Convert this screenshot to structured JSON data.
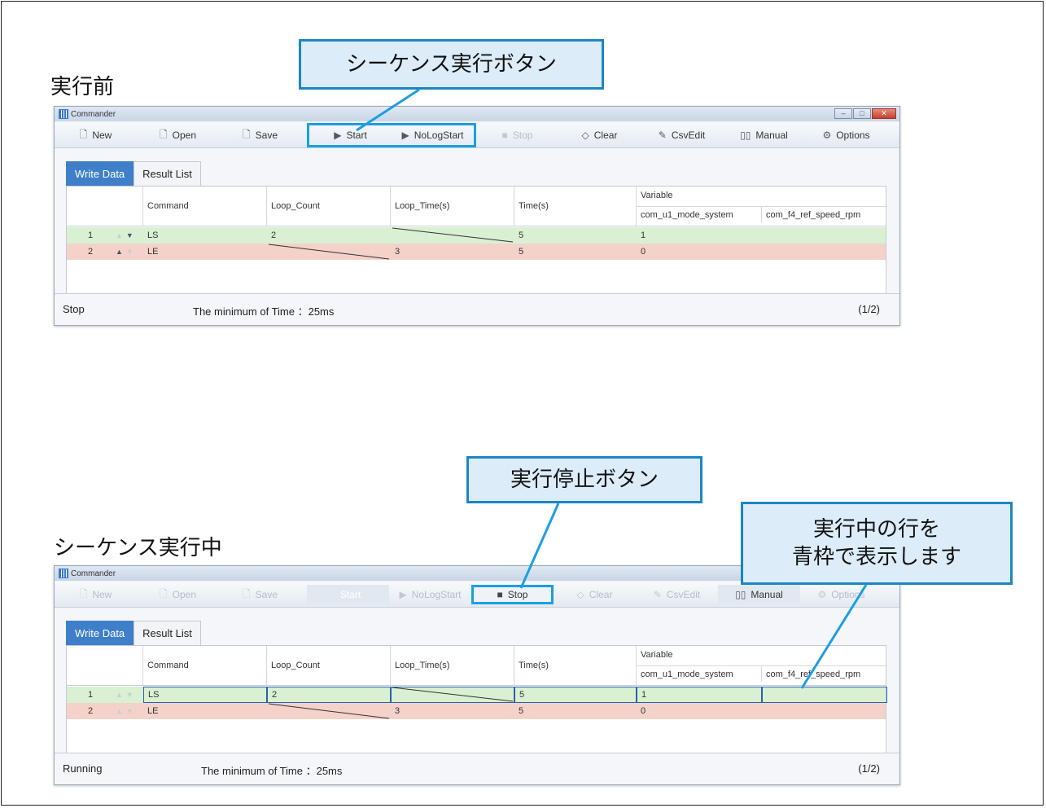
{
  "top": {
    "heading": "実行前",
    "callout": "シーケンス実行ボタン",
    "window": {
      "title": "Commander",
      "toolbar": [
        {
          "label": "New",
          "icon": "new-doc-icon",
          "glyph": "🗋"
        },
        {
          "label": "Open",
          "icon": "open-icon",
          "glyph": "🗋"
        },
        {
          "label": "Save",
          "icon": "save-icon",
          "glyph": "🗋"
        },
        {
          "label": "Start",
          "icon": "play-icon",
          "glyph": "▶"
        },
        {
          "label": "NoLogStart",
          "icon": "play-icon",
          "glyph": "▶"
        },
        {
          "label": "Stop",
          "icon": "stop-icon",
          "glyph": "■"
        },
        {
          "label": "Clear",
          "icon": "eraser-icon",
          "glyph": "◇"
        },
        {
          "label": "CsvEdit",
          "icon": "pencil-icon",
          "glyph": "✎"
        },
        {
          "label": "Manual",
          "icon": "book-icon",
          "glyph": "▯▯"
        },
        {
          "label": "Options",
          "icon": "gear-icon",
          "glyph": "⚙"
        }
      ],
      "tabs": [
        "Write Data",
        "Result List"
      ],
      "columns": {
        "command": "Command",
        "loop_count": "Loop_Count",
        "loop_time": "Loop_Time(s)",
        "time": "Time(s)",
        "variable": "Variable",
        "var1": "com_u1_mode_system",
        "var2": "com_f4_ref_speed_rpm"
      },
      "rows": [
        {
          "num": "1",
          "command": "LS",
          "loop_count": "2",
          "loop_time": "",
          "time": "5",
          "var1": "1",
          "var2": ""
        },
        {
          "num": "2",
          "command": "LE",
          "loop_count": "",
          "loop_time": "3",
          "time": "5",
          "var1": "0",
          "var2": ""
        }
      ],
      "status": {
        "state": "Stop",
        "info": "The minimum of Time ：25ms",
        "page": "(1/2)"
      }
    }
  },
  "bottom": {
    "heading": "シーケンス実行中",
    "callout_stop": "実行停止ボタン",
    "callout_row_line1": "実行中の行を",
    "callout_row_line2": "青枠で表示します",
    "window": {
      "title": "Commander",
      "toolbar": [
        {
          "label": "New",
          "icon": "new-doc-icon",
          "glyph": "🗋"
        },
        {
          "label": "Open",
          "icon": "open-icon",
          "glyph": "🗋"
        },
        {
          "label": "Save",
          "icon": "save-icon",
          "glyph": "🗋"
        },
        {
          "label": "Start",
          "icon": "play-icon",
          "glyph": ""
        },
        {
          "label": "NoLogStart",
          "icon": "play-icon",
          "glyph": "▶"
        },
        {
          "label": "Stop",
          "icon": "stop-icon",
          "glyph": "■"
        },
        {
          "label": "Clear",
          "icon": "eraser-icon",
          "glyph": "◇"
        },
        {
          "label": "CsvEdit",
          "icon": "pencil-icon",
          "glyph": "✎"
        },
        {
          "label": "Manual",
          "icon": "book-icon",
          "glyph": "▯▯"
        },
        {
          "label": "Options",
          "icon": "gear-icon",
          "glyph": "⚙"
        }
      ],
      "tabs": [
        "Write Data",
        "Result List"
      ],
      "columns": {
        "command": "Command",
        "loop_count": "Loop_Count",
        "loop_time": "Loop_Time(s)",
        "time": "Time(s)",
        "variable": "Variable",
        "var1": "com_u1_mode_system",
        "var2": "com_f4_ref_speed_rpm"
      },
      "rows": [
        {
          "num": "1",
          "command": "LS",
          "loop_count": "2",
          "loop_time": "",
          "time": "5",
          "var1": "1",
          "var2": ""
        },
        {
          "num": "2",
          "command": "LE",
          "loop_count": "",
          "loop_time": "3",
          "time": "5",
          "var1": "0",
          "var2": ""
        }
      ],
      "status": {
        "state": "Running",
        "info": "The minimum of Time ：25ms",
        "page": "(1/2)"
      }
    }
  },
  "colors": {
    "accent": "#1b86c8",
    "tab_active": "#3f7fc9",
    "row_ls": "#d9f0d2",
    "row_le": "#f4d2c9"
  }
}
